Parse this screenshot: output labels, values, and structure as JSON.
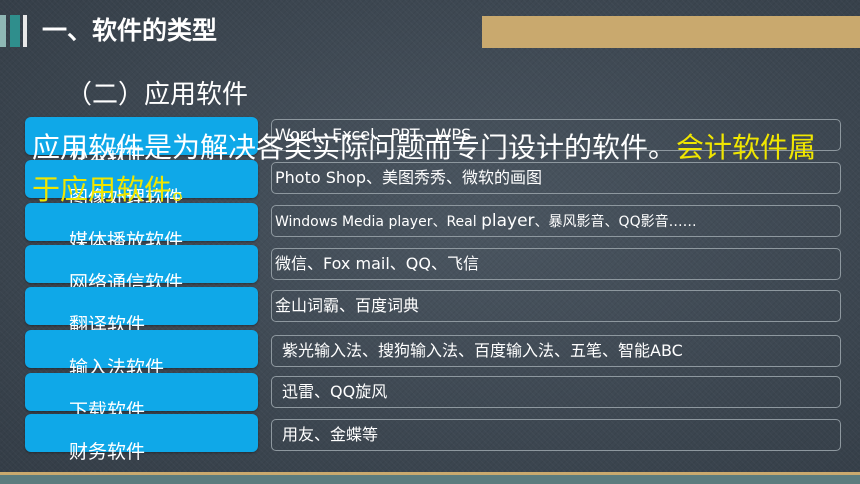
{
  "slide": {
    "heading": "一、软件的类型",
    "subheading": "（二）应用软件"
  },
  "categories": [
    {
      "label": "办公软件",
      "examples": "Word、Excel、PPT、WPS"
    },
    {
      "label": "图像处理软件",
      "examples": "Photo Shop、美图秀秀、微软的画图"
    },
    {
      "label": "媒体播放软件",
      "examples_pre": "Windows Media player、Real ",
      "examples_big": "player",
      "examples_post": "、暴风影音、QQ影音……"
    },
    {
      "label": "网络通信软件",
      "examples": "微信、Fox mail、QQ、飞信"
    },
    {
      "label": "翻译软件",
      "examples": "金山词霸、百度词典"
    },
    {
      "label": "输入法软件",
      "examples": "紫光输入法、搜狗输入法、百度输入法、五笔、智能ABC"
    },
    {
      "label": "下载软件",
      "examples": "迅雷、QQ旋风"
    },
    {
      "label": "财务软件",
      "examples": "用友、金蝶等"
    }
  ],
  "intro": {
    "text": "应用软件是为解决各类实际问题而专门设计的软件。",
    "highlight": "会计软件属于应用软件。"
  },
  "colors": {
    "button": "#0fa8e8",
    "highlight": "#f0e600",
    "accent": "#c9a96e",
    "teal": "#2f8e8c"
  }
}
